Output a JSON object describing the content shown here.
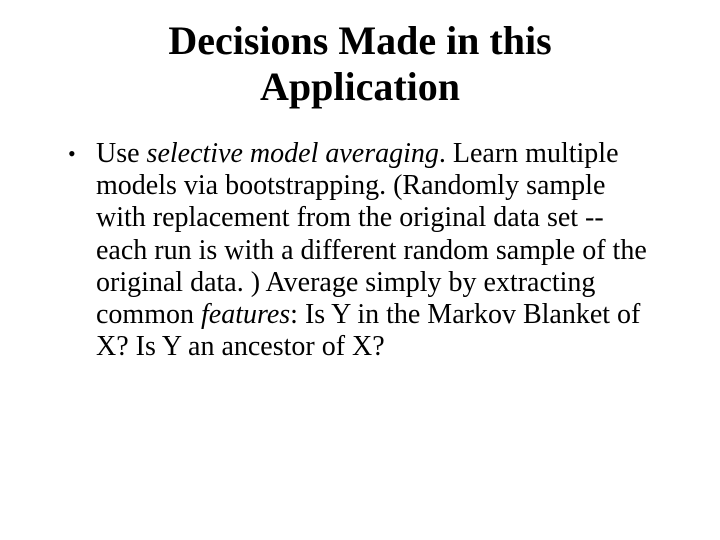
{
  "title_line1": "Decisions Made in this",
  "title_line2": "Application",
  "bullet": {
    "t1": "Use ",
    "i1": "selective model averaging",
    "t2": ".  Learn multiple models via bootstrapping.  (Randomly sample with replacement from the original data set -- each run is with a different random sample of the original data. )  Average simply by extracting common ",
    "i2": "features",
    "t3": ": Is Y in the Markov Blanket of X?  Is Y an ancestor of X?"
  }
}
